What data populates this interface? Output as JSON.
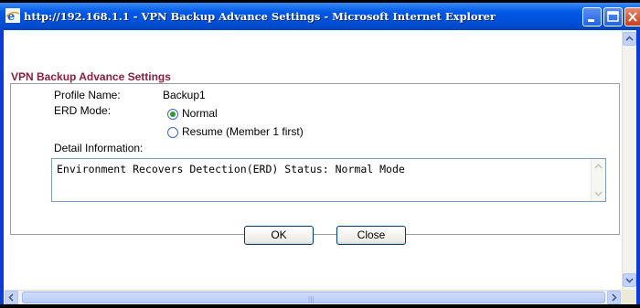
{
  "window": {
    "title": "http://192.168.1.1 - VPN Backup Advance Settings - Microsoft Internet Explorer"
  },
  "page": {
    "heading": "VPN Backup Advance Settings",
    "profile_name_label": "Profile Name:",
    "profile_name_value": "Backup1",
    "erd_mode_label": "ERD Mode:",
    "erd_options": [
      {
        "label": "Normal",
        "selected": true
      },
      {
        "label": "Resume (Member 1 first)",
        "selected": false
      }
    ],
    "detail_label": "Detail Information:",
    "detail_text": "Environment Recovers Detection(ERD) Status: Normal Mode"
  },
  "buttons": {
    "ok": "OK",
    "close": "Close"
  },
  "colors": {
    "heading": "#8a1e3c",
    "titlebar": "#0058e6",
    "radio_dot": "#2a9a34"
  },
  "icons": [
    "ie-icon",
    "minimize-icon",
    "maximize-icon",
    "close-icon",
    "scroll-up-icon",
    "scroll-down-icon",
    "scroll-left-icon",
    "scroll-right-icon"
  ]
}
